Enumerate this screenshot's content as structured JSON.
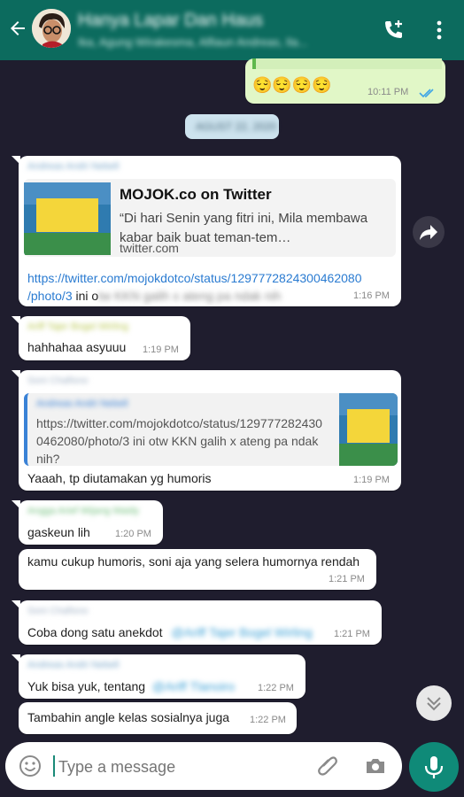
{
  "header": {
    "title": "Hanya Lapar Dan Haus",
    "subtitle": "Ika, Agung Wirakesma, Alfiaun Andreas, Ila..."
  },
  "messages": {
    "top": {
      "emoji": "😌😌😌😌",
      "time": "10:11 PM"
    },
    "date_chip": "AGUST 22, 2020",
    "m1": {
      "sender": "Andreas Andri Nebell",
      "link_title": "MOJOK.co on Twitter",
      "link_desc": "“Di hari Senin yang fitri ini, Mila membawa kabar baik buat teman-tem…",
      "link_domain": "twitter.com",
      "url_line1": "https://twitter.com/mojokdotco/status/1297772824300462080",
      "url_line2": "/photo/3",
      "text_after": " ini o",
      "blurred": "tw KKN galih x ateng pa ndak nih",
      "time": "1:16 PM"
    },
    "m2": {
      "sender": "Ariff Tajer Bogel Wirling",
      "text": "hahhahaa asyuuu",
      "time": "1:19 PM"
    },
    "m3": {
      "sender": "Soni Chafisno",
      "quote_sender": "Andreas Andri Nebell",
      "quote_text": "https://twitter.com/mojokdotco/status/1297772824300462080/photo/3 ini otw KKN galih x ateng pa ndak nih?",
      "text": "Yaaah, tp diutamakan yg humoris",
      "time": "1:19 PM"
    },
    "m4": {
      "sender": "Angga Arief Wijang Maidy",
      "text": "gaskeun lih",
      "time": "1:20 PM"
    },
    "m5": {
      "text": "kamu cukup humoris, soni aja yang selera humornya rendah",
      "time": "1:21 PM"
    },
    "m6": {
      "sender": "Soni Chafisno",
      "text": "Coba dong satu anekdot",
      "mention": "@Ariff Tajer Bogel Wirling",
      "time": "1:21 PM"
    },
    "m7": {
      "sender": "Andreas Andri Nebell",
      "text": "Yuk bisa yuk, tentang",
      "mention": "@Ariff Tlanoiro",
      "time": "1:22 PM"
    },
    "m8": {
      "text": "Tambahin angle kelas sosialnya juga",
      "time": "1:22 PM"
    }
  },
  "input": {
    "placeholder": "Type a message"
  },
  "colors": {
    "header": "#0c6b5e",
    "background": "#1f1d2e",
    "outgoing": "#e1f7c7",
    "link": "#2a7bd1",
    "mic": "#0f8a78"
  },
  "icons": [
    "back-arrow-icon",
    "add-call-icon",
    "more-vert-icon",
    "forward-icon",
    "double-check-icon",
    "chevron-down-icon",
    "emoji-icon",
    "attach-icon",
    "camera-icon",
    "mic-icon"
  ]
}
